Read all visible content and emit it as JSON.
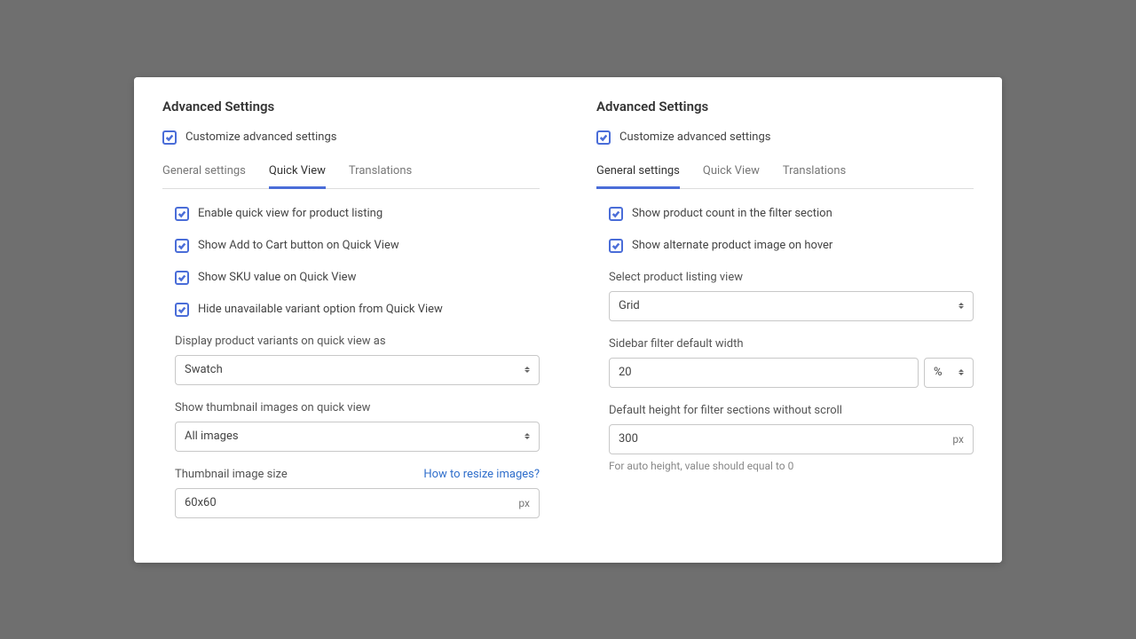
{
  "left": {
    "title": "Advanced Settings",
    "customize_label": "Customize advanced settings",
    "tabs": {
      "general": "General settings",
      "quick": "Quick View",
      "translations": "Translations"
    },
    "opts": {
      "enable_qv": "Enable quick view for product listing",
      "add_cart": "Show Add to Cart button on Quick View",
      "show_sku": "Show SKU value on Quick View",
      "hide_unavail": "Hide unavailable variant option from Quick View"
    },
    "variants_label": "Display product variants on quick view as",
    "variants_value": "Swatch",
    "thumbs_label": "Show thumbnail images on quick view",
    "thumbs_value": "All images",
    "size_label": "Thumbnail image size",
    "size_link": "How to resize images?",
    "size_value": "60x60",
    "size_unit": "px"
  },
  "right": {
    "title": "Advanced Settings",
    "customize_label": "Customize advanced settings",
    "tabs": {
      "general": "General settings",
      "quick": "Quick View",
      "translations": "Translations"
    },
    "opts": {
      "show_count": "Show product count in the filter section",
      "alt_image": "Show alternate product image on hover"
    },
    "view_label": "Select product listing view",
    "view_value": "Grid",
    "width_label": "Sidebar filter default width",
    "width_value": "20",
    "width_unit": "%",
    "height_label": "Default height for filter sections without scroll",
    "height_value": "300",
    "height_unit": "px",
    "height_hint": "For auto height, value should equal to 0"
  }
}
